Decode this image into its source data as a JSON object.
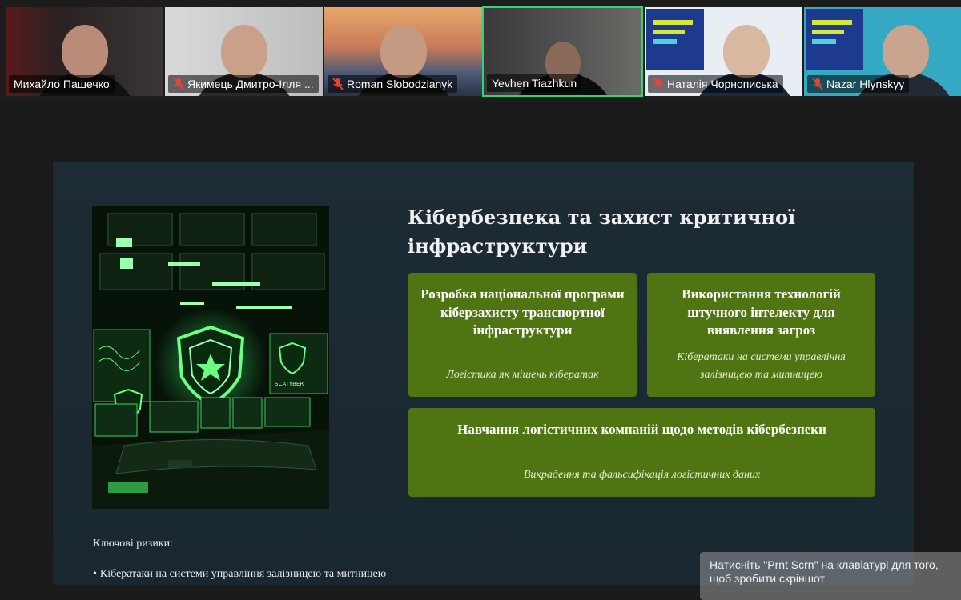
{
  "participants": [
    {
      "name": "Михайло Пашечко",
      "muted": false,
      "active": false
    },
    {
      "name": "Якимець Дмитро-Ілля ...",
      "muted": true,
      "active": false
    },
    {
      "name": "Roman Slobodzianyk",
      "muted": true,
      "active": false
    },
    {
      "name": "Yevhen Tiazhkun",
      "muted": false,
      "active": true
    },
    {
      "name": "Наталія Чорнописька",
      "muted": true,
      "active": false
    },
    {
      "name": "Nazar Hlynskyy",
      "muted": true,
      "active": false
    }
  ],
  "slide": {
    "title": "Кібербезпека та захист критичної інфраструктури",
    "image_label": "SCATYBER",
    "cards": [
      {
        "title": "Розробка національної програми кіберзахисту транспортної інфраструктури",
        "subtitle": "Логістика як мішень кібератак"
      },
      {
        "title": "Використання технологій штучного інтелекту для виявлення загроз",
        "subtitle": "Кібератаки на системи управління залізницею та митницею"
      },
      {
        "title": "Навчання логістичних компаній щодо методів кібербезпеки",
        "subtitle": "Викрадення та фальсифікація логістичних даних"
      }
    ],
    "risks_label": "Ключові ризики:",
    "risks": [
      "Кібератаки на системи управління залізницею та митницею"
    ]
  },
  "toast": {
    "text": "Натисніть \"Prnt Scrn\" на клавіатурі для того, щоб зробити скріншот"
  },
  "colors": {
    "card_bg": "#4f7512",
    "active_border": "#2ed47a",
    "slide_bg": "#1d2b35",
    "page_bg": "#1a1a1a"
  }
}
